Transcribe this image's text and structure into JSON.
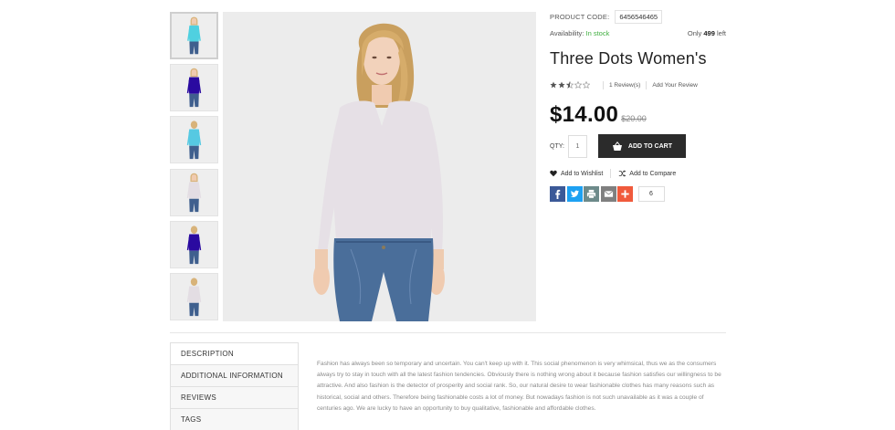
{
  "product": {
    "code_label": "PRODUCT CODE:",
    "code": "6456546465",
    "availability_label": "Availability:",
    "availability": "In stock",
    "only_prefix": "Only",
    "stock_count": "499",
    "stock_suffix": "left",
    "title": "Three Dots Women's",
    "rating": 2.5,
    "rating_max": 5,
    "reviews_link": "1 Review(s)",
    "add_review_link": "Add Your Review",
    "price": "$14.00",
    "old_price": "$20.00",
    "qty_label": "QTY:",
    "qty_value": "1",
    "add_to_cart": "ADD TO CART",
    "wishlist": "Add to Wishlist",
    "compare": "Add to Compare",
    "share_count": "6"
  },
  "share": {
    "colors": {
      "facebook": "#3b5998",
      "twitter": "#1da1f2",
      "print": "#6d8a8a",
      "email": "#7f7f7f",
      "more": "#f05a3c"
    }
  },
  "gallery": {
    "thumbnails": [
      {
        "shirt": "#4fd0e0",
        "hair": "#d8b37a",
        "pose": "front"
      },
      {
        "shirt": "#2a0aa0",
        "hair": "#d8b37a",
        "pose": "front"
      },
      {
        "shirt": "#56c9e2",
        "hair": "#d8b37a",
        "pose": "back"
      },
      {
        "shirt": "#e3dde3",
        "hair": "#d8b37a",
        "pose": "front"
      },
      {
        "shirt": "#2a0aa0",
        "hair": "#d8b37a",
        "pose": "back"
      },
      {
        "shirt": "#e3dde3",
        "hair": "#d8b37a",
        "pose": "back"
      }
    ],
    "main_shirt": "#e6e0e6"
  },
  "tabs": {
    "items": [
      "DESCRIPTION",
      "ADDITIONAL INFORMATION",
      "REVIEWS",
      "TAGS"
    ],
    "active_index": 0,
    "description": "Fashion has always been so temporary and uncertain. You can't keep up with it. This social phenomenon is very whimsical, thus we as the consumers always try to stay in touch with all the latest fashion tendencies. Obviously there is nothing wrong about it because fashion satisfies our willingness to be attractive. And also fashion is the detector of prosperity and social rank. So, our natural desire to wear fashionable clothes has many reasons such as historical, social and others. Therefore being fashionable costs a lot of money. But nowadays fashion is not such unavailable as it was a couple of centuries ago. We are lucky to have an opportunity to buy qualitative, fashionable and affordable clothes."
  }
}
